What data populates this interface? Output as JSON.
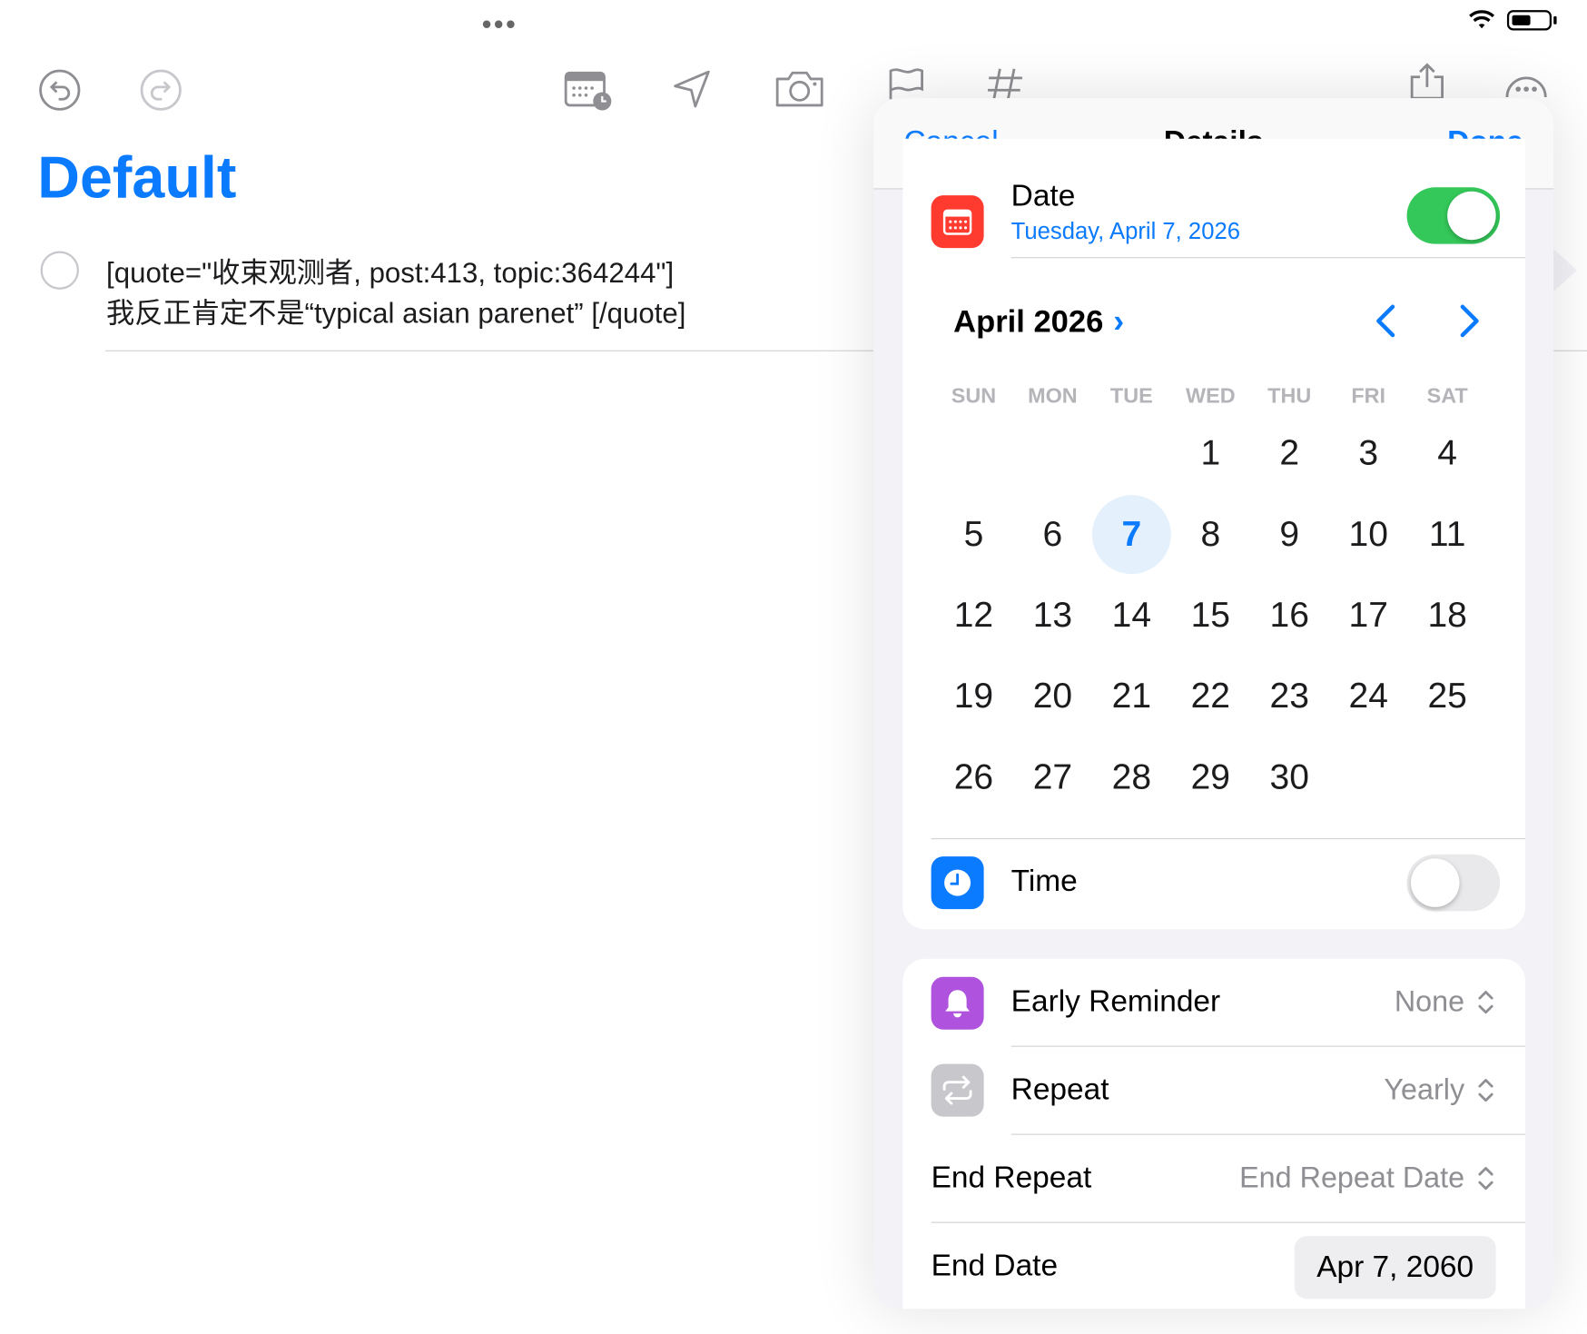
{
  "toolbar": {
    "icons": [
      "undo-icon",
      "redo-icon",
      "calendar-clock-icon",
      "location-icon",
      "camera-icon",
      "flag-icon",
      "tag-icon",
      "share-icon",
      "more-icon"
    ]
  },
  "list": {
    "title": "Default",
    "task_line1": "[quote=\"收束观测者, post:413, topic:364244\"]",
    "task_line2": "我反正肯定不是“typical asian parenet” [/quote]"
  },
  "details": {
    "cancel": "Cancel",
    "title": "Details",
    "done": "Done",
    "date_label": "Date",
    "date_value": "Tuesday, April 7, 2026",
    "date_enabled": true,
    "month": "April 2026",
    "weekdays": [
      "SUN",
      "MON",
      "TUE",
      "WED",
      "THU",
      "FRI",
      "SAT"
    ],
    "days": [
      "1",
      "2",
      "3",
      "4",
      "5",
      "6",
      "7",
      "8",
      "9",
      "10",
      "11",
      "12",
      "13",
      "14",
      "15",
      "16",
      "17",
      "18",
      "19",
      "20",
      "21",
      "22",
      "23",
      "24",
      "25",
      "26",
      "27",
      "28",
      "29",
      "30"
    ],
    "first_weekday": 3,
    "selected_day": 7,
    "time_label": "Time",
    "time_enabled": false,
    "early_reminder_label": "Early Reminder",
    "early_reminder_value": "None",
    "repeat_label": "Repeat",
    "repeat_value": "Yearly",
    "end_repeat_label": "End Repeat",
    "end_repeat_value": "End Repeat Date",
    "end_date_label": "End Date",
    "end_date_value": "Apr 7, 2060"
  },
  "colors": {
    "accent": "#0a7aff",
    "toggle_on": "#34c759",
    "calendar_icon": "#ff3b30",
    "time_icon": "#0a7aff",
    "reminder_icon": "#af52de",
    "repeat_icon": "#c7c7cc"
  }
}
